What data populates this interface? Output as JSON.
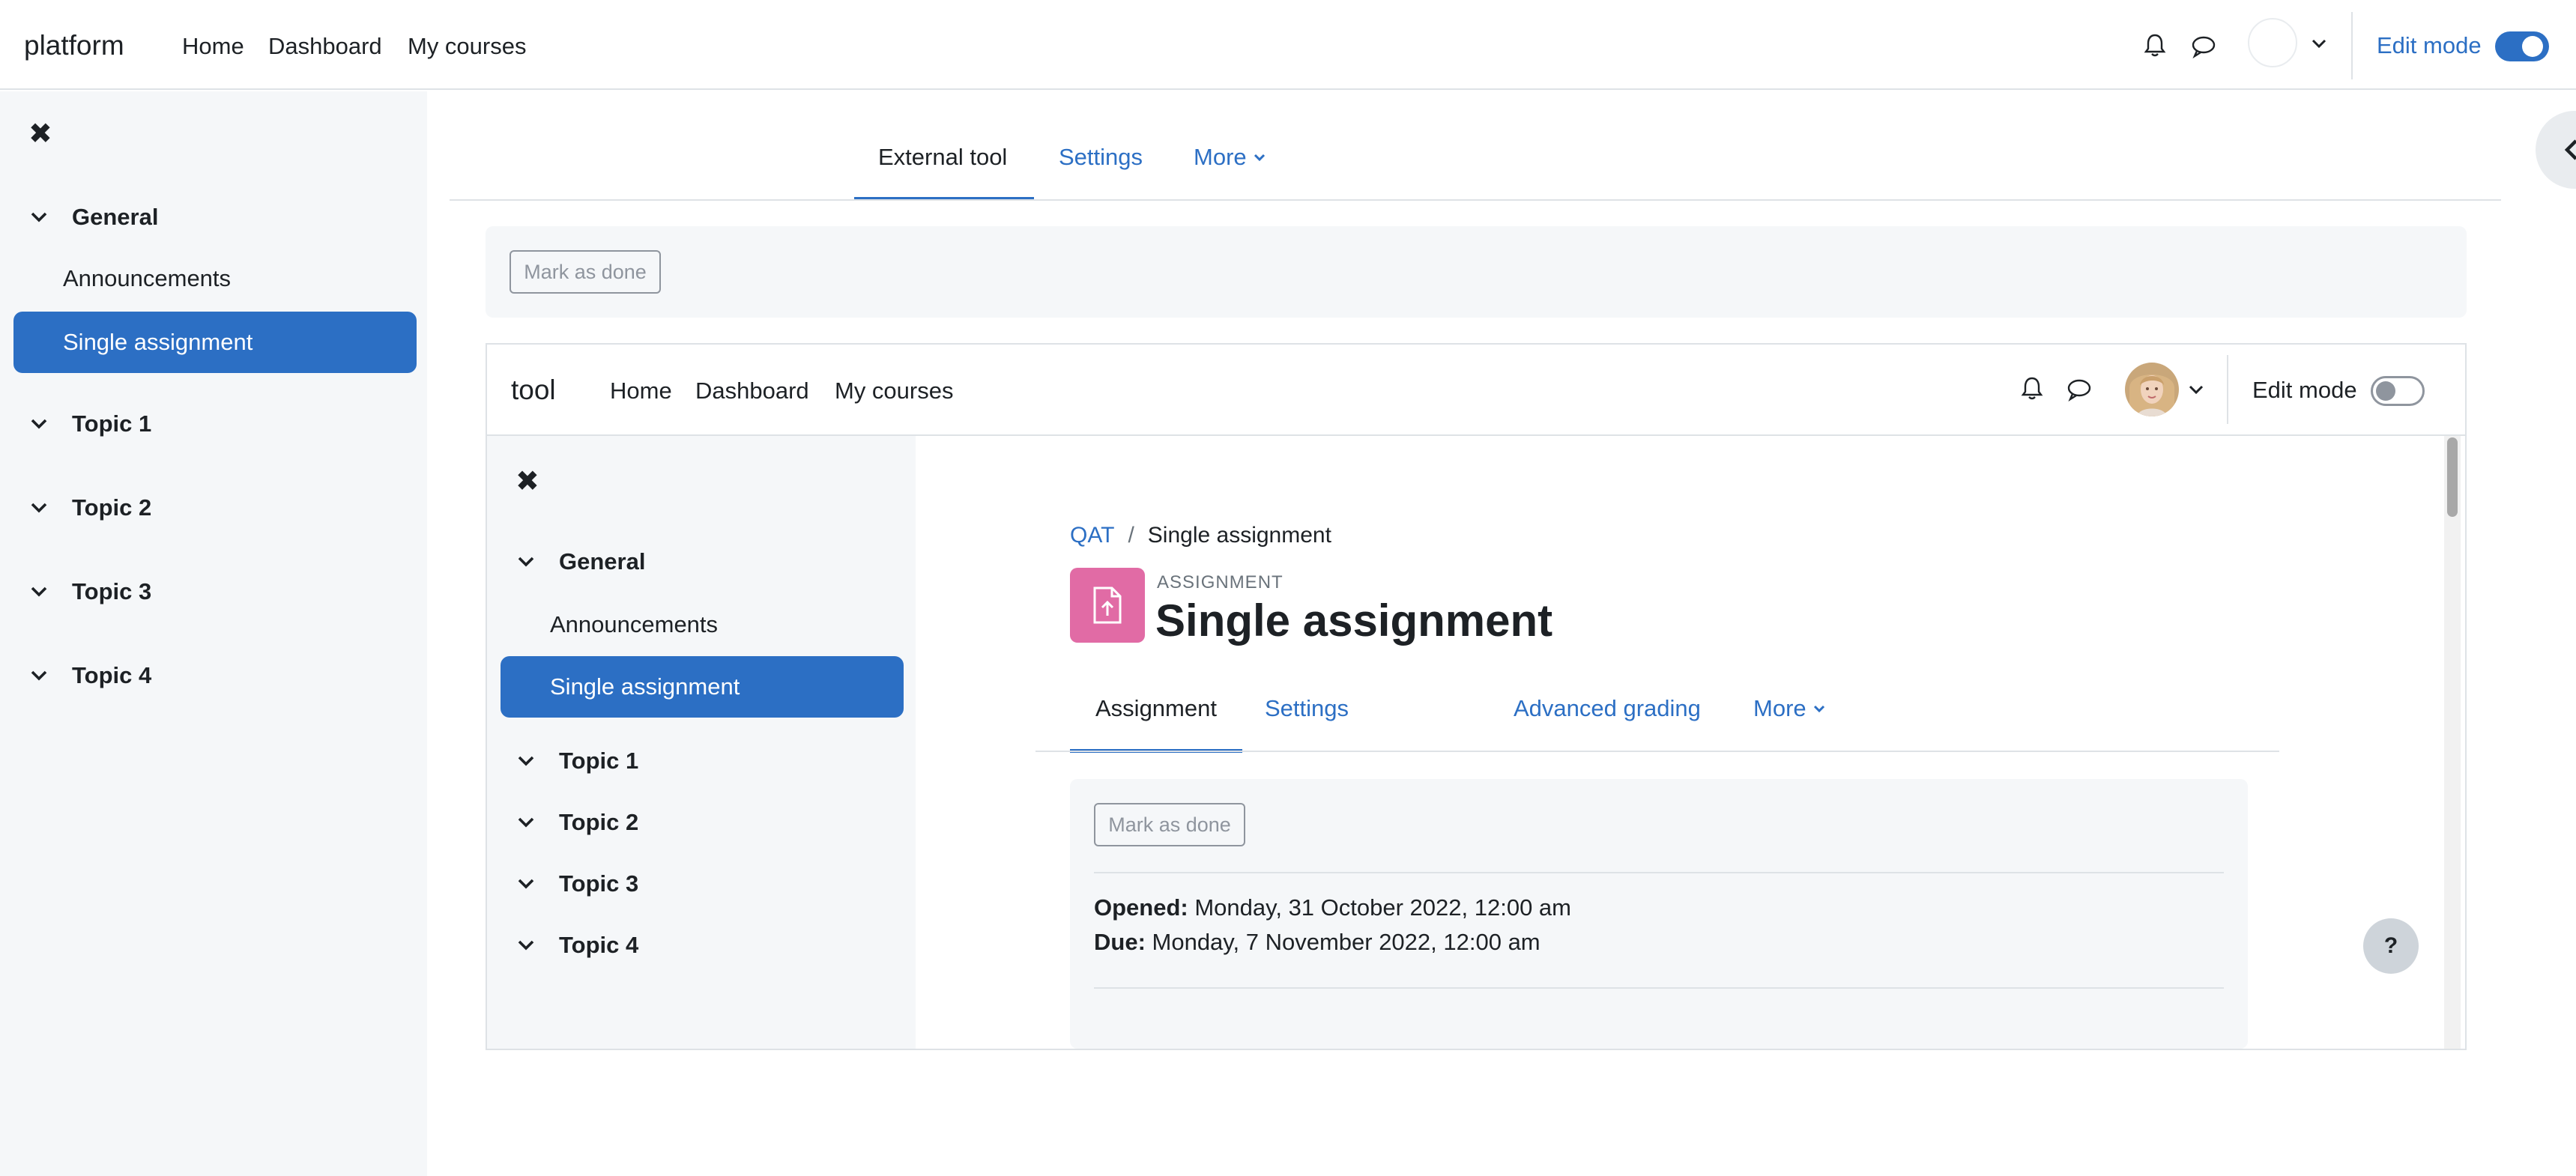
{
  "outer": {
    "brand": "platform",
    "nav": [
      "Home",
      "Dashboard",
      "My courses"
    ],
    "edit_mode_label": "Edit mode",
    "edit_mode_on": true,
    "drawer": {
      "general": "General",
      "announcements": "Announcements",
      "single_assignment": "Single assignment",
      "topics": [
        "Topic 1",
        "Topic 2",
        "Topic 3",
        "Topic 4"
      ]
    },
    "tabs": [
      "External tool",
      "Settings",
      "More"
    ],
    "mark_done": "Mark as done"
  },
  "inner": {
    "brand": "tool",
    "nav": [
      "Home",
      "Dashboard",
      "My courses"
    ],
    "edit_mode_label": "Edit mode",
    "edit_mode_on": false,
    "drawer": {
      "general": "General",
      "announcements": "Announcements",
      "single_assignment": "Single assignment",
      "topics": [
        "Topic 1",
        "Topic 2",
        "Topic 3",
        "Topic 4"
      ]
    },
    "breadcrumb": {
      "course": "QAT",
      "separator": "/",
      "current": "Single assignment"
    },
    "activity_type": "ASSIGNMENT",
    "title": "Single assignment",
    "tabs": [
      "Assignment",
      "Settings",
      "Advanced grading",
      "More"
    ],
    "mark_done": "Mark as done",
    "opened_label": "Opened:",
    "opened_value": "Monday, 31 October 2022, 12:00 am",
    "due_label": "Due:",
    "due_value": "Monday, 7 November 2022, 12:00 am"
  },
  "help": "?",
  "colors": {
    "primary": "#2c6fc4",
    "assignment_icon": "#e16ba5",
    "drawer_bg": "#f5f7f9"
  }
}
